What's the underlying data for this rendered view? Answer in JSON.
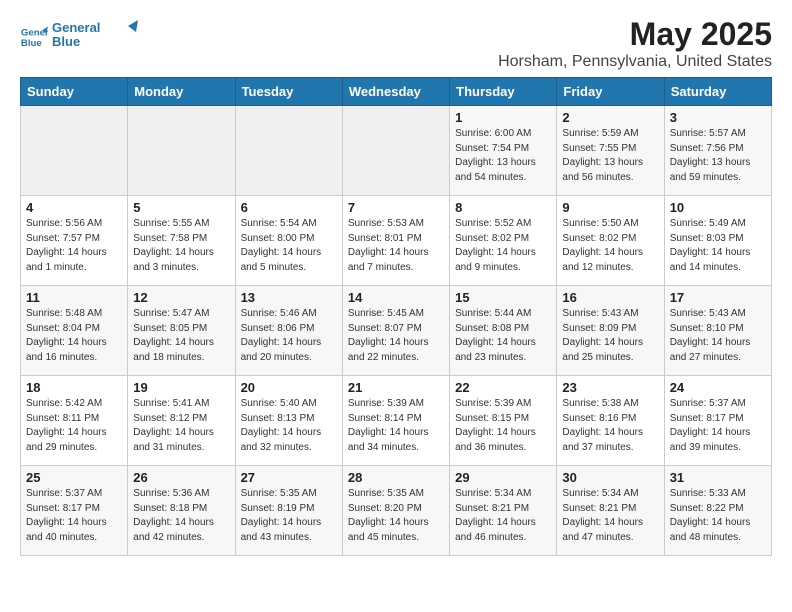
{
  "header": {
    "logo_line1": "General",
    "logo_line2": "Blue",
    "title": "May 2025",
    "subtitle": "Horsham, Pennsylvania, United States"
  },
  "weekdays": [
    "Sunday",
    "Monday",
    "Tuesday",
    "Wednesday",
    "Thursday",
    "Friday",
    "Saturday"
  ],
  "weeks": [
    [
      {
        "date": "",
        "info": ""
      },
      {
        "date": "",
        "info": ""
      },
      {
        "date": "",
        "info": ""
      },
      {
        "date": "",
        "info": ""
      },
      {
        "date": "1",
        "info": "Sunrise: 6:00 AM\nSunset: 7:54 PM\nDaylight: 13 hours\nand 54 minutes."
      },
      {
        "date": "2",
        "info": "Sunrise: 5:59 AM\nSunset: 7:55 PM\nDaylight: 13 hours\nand 56 minutes."
      },
      {
        "date": "3",
        "info": "Sunrise: 5:57 AM\nSunset: 7:56 PM\nDaylight: 13 hours\nand 59 minutes."
      }
    ],
    [
      {
        "date": "4",
        "info": "Sunrise: 5:56 AM\nSunset: 7:57 PM\nDaylight: 14 hours\nand 1 minute."
      },
      {
        "date": "5",
        "info": "Sunrise: 5:55 AM\nSunset: 7:58 PM\nDaylight: 14 hours\nand 3 minutes."
      },
      {
        "date": "6",
        "info": "Sunrise: 5:54 AM\nSunset: 8:00 PM\nDaylight: 14 hours\nand 5 minutes."
      },
      {
        "date": "7",
        "info": "Sunrise: 5:53 AM\nSunset: 8:01 PM\nDaylight: 14 hours\nand 7 minutes."
      },
      {
        "date": "8",
        "info": "Sunrise: 5:52 AM\nSunset: 8:02 PM\nDaylight: 14 hours\nand 9 minutes."
      },
      {
        "date": "9",
        "info": "Sunrise: 5:50 AM\nSunset: 8:02 PM\nDaylight: 14 hours\nand 12 minutes."
      },
      {
        "date": "10",
        "info": "Sunrise: 5:49 AM\nSunset: 8:03 PM\nDaylight: 14 hours\nand 14 minutes."
      }
    ],
    [
      {
        "date": "11",
        "info": "Sunrise: 5:48 AM\nSunset: 8:04 PM\nDaylight: 14 hours\nand 16 minutes."
      },
      {
        "date": "12",
        "info": "Sunrise: 5:47 AM\nSunset: 8:05 PM\nDaylight: 14 hours\nand 18 minutes."
      },
      {
        "date": "13",
        "info": "Sunrise: 5:46 AM\nSunset: 8:06 PM\nDaylight: 14 hours\nand 20 minutes."
      },
      {
        "date": "14",
        "info": "Sunrise: 5:45 AM\nSunset: 8:07 PM\nDaylight: 14 hours\nand 22 minutes."
      },
      {
        "date": "15",
        "info": "Sunrise: 5:44 AM\nSunset: 8:08 PM\nDaylight: 14 hours\nand 23 minutes."
      },
      {
        "date": "16",
        "info": "Sunrise: 5:43 AM\nSunset: 8:09 PM\nDaylight: 14 hours\nand 25 minutes."
      },
      {
        "date": "17",
        "info": "Sunrise: 5:43 AM\nSunset: 8:10 PM\nDaylight: 14 hours\nand 27 minutes."
      }
    ],
    [
      {
        "date": "18",
        "info": "Sunrise: 5:42 AM\nSunset: 8:11 PM\nDaylight: 14 hours\nand 29 minutes."
      },
      {
        "date": "19",
        "info": "Sunrise: 5:41 AM\nSunset: 8:12 PM\nDaylight: 14 hours\nand 31 minutes."
      },
      {
        "date": "20",
        "info": "Sunrise: 5:40 AM\nSunset: 8:13 PM\nDaylight: 14 hours\nand 32 minutes."
      },
      {
        "date": "21",
        "info": "Sunrise: 5:39 AM\nSunset: 8:14 PM\nDaylight: 14 hours\nand 34 minutes."
      },
      {
        "date": "22",
        "info": "Sunrise: 5:39 AM\nSunset: 8:15 PM\nDaylight: 14 hours\nand 36 minutes."
      },
      {
        "date": "23",
        "info": "Sunrise: 5:38 AM\nSunset: 8:16 PM\nDaylight: 14 hours\nand 37 minutes."
      },
      {
        "date": "24",
        "info": "Sunrise: 5:37 AM\nSunset: 8:17 PM\nDaylight: 14 hours\nand 39 minutes."
      }
    ],
    [
      {
        "date": "25",
        "info": "Sunrise: 5:37 AM\nSunset: 8:17 PM\nDaylight: 14 hours\nand 40 minutes."
      },
      {
        "date": "26",
        "info": "Sunrise: 5:36 AM\nSunset: 8:18 PM\nDaylight: 14 hours\nand 42 minutes."
      },
      {
        "date": "27",
        "info": "Sunrise: 5:35 AM\nSunset: 8:19 PM\nDaylight: 14 hours\nand 43 minutes."
      },
      {
        "date": "28",
        "info": "Sunrise: 5:35 AM\nSunset: 8:20 PM\nDaylight: 14 hours\nand 45 minutes."
      },
      {
        "date": "29",
        "info": "Sunrise: 5:34 AM\nSunset: 8:21 PM\nDaylight: 14 hours\nand 46 minutes."
      },
      {
        "date": "30",
        "info": "Sunrise: 5:34 AM\nSunset: 8:21 PM\nDaylight: 14 hours\nand 47 minutes."
      },
      {
        "date": "31",
        "info": "Sunrise: 5:33 AM\nSunset: 8:22 PM\nDaylight: 14 hours\nand 48 minutes."
      }
    ]
  ]
}
